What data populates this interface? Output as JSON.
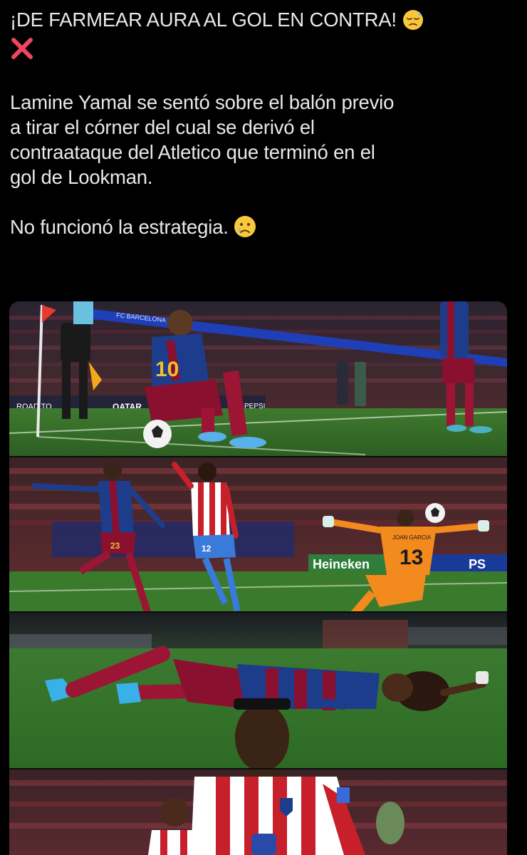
{
  "tweet": {
    "headline": "¡DE FARMEAR AURA AL GOL EN CONTRA!",
    "headline_emoji": "downcast-face-with-sweat-emoji",
    "cross_emoji": "cross-mark-emoji",
    "body_lines": [
      "Lamine Yamal se sentó sobre el balón previo",
      "a tirar el córner del cual se derivó el",
      "contraataque del Atletico que terminó en el",
      "gol de Lookman."
    ],
    "closing": "No funcionó la estrategia.",
    "closing_emoji": "crying-face-emoji"
  },
  "media": {
    "photo1": {
      "banner_left": "ROAD TO",
      "banner_sponsor": "QATAR",
      "banner_club": "FC BARCELONA",
      "banner_right": "PEPSI",
      "shirt_number": "10"
    },
    "photo2": {
      "ad_heineken": "Heineken",
      "ad_ps": "PS",
      "keeper_number": "13",
      "keeper_name": "JOAN GARCIA",
      "defender_number": "23",
      "attacker_number": "12"
    }
  },
  "colors": {
    "background": "#000000",
    "text": "#e7e9ea",
    "pitch": "#2f6a2a",
    "barca_blue": "#1d3d8c",
    "barca_red": "#8a1030",
    "atletico_red": "#c8202a",
    "keeper_orange": "#f28a1e"
  }
}
